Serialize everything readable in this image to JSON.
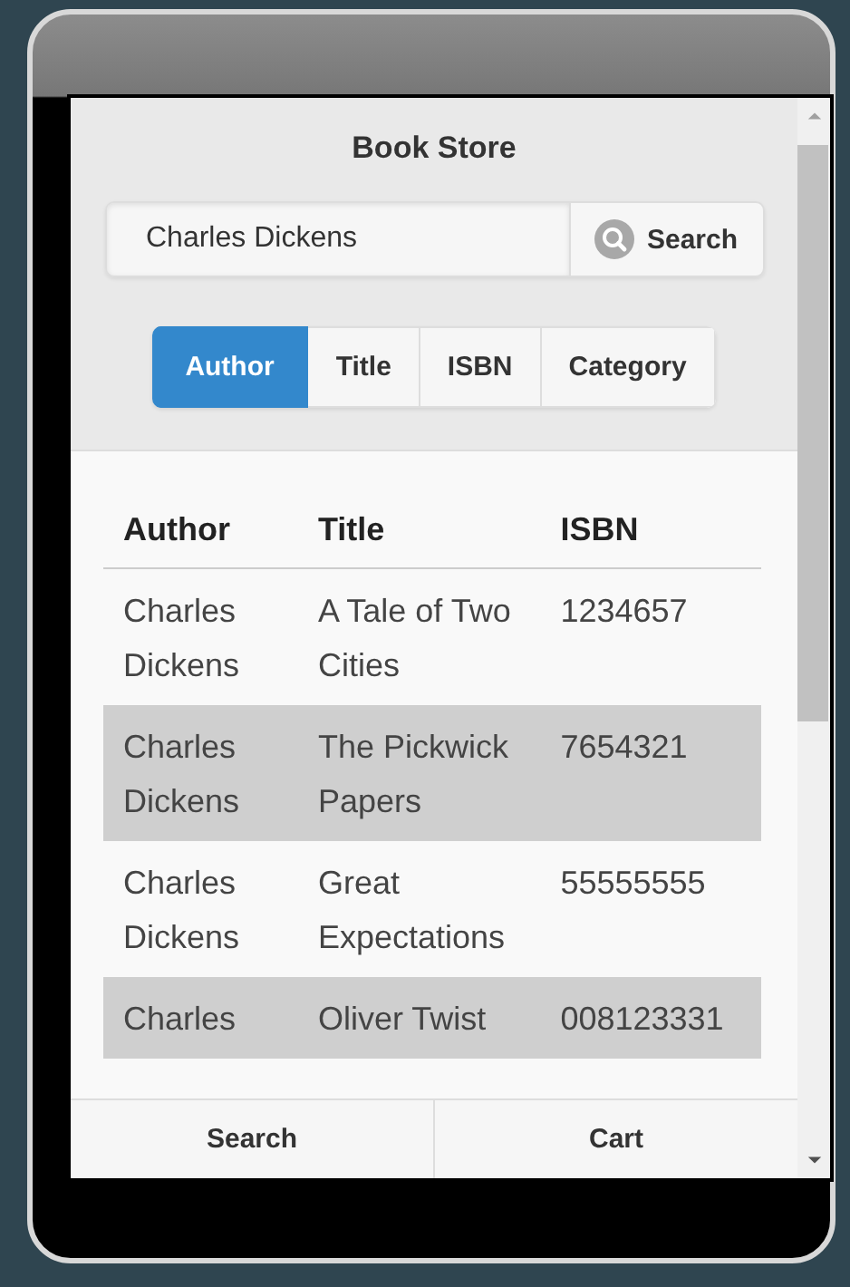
{
  "app": {
    "title": "Book Store"
  },
  "search": {
    "value": "Charles Dickens",
    "button": "Search"
  },
  "filter_tabs": [
    {
      "label": "Author",
      "selected": true
    },
    {
      "label": "Title",
      "selected": false
    },
    {
      "label": "ISBN",
      "selected": false
    },
    {
      "label": "Category",
      "selected": false
    }
  ],
  "table": {
    "columns": [
      "Author",
      "Title",
      "ISBN"
    ],
    "rows": [
      [
        "Charles Dickens",
        "A Tale of Two Cities",
        "1234657"
      ],
      [
        "Charles Dickens",
        "The Pickwick Papers",
        "7654321"
      ],
      [
        "Charles Dickens",
        "Great Expectations",
        "55555555"
      ],
      [
        "Charles",
        "Oliver Twist",
        "008123331"
      ]
    ]
  },
  "nav_bar": [
    {
      "label": "Search"
    },
    {
      "label": "Cart"
    }
  ]
}
